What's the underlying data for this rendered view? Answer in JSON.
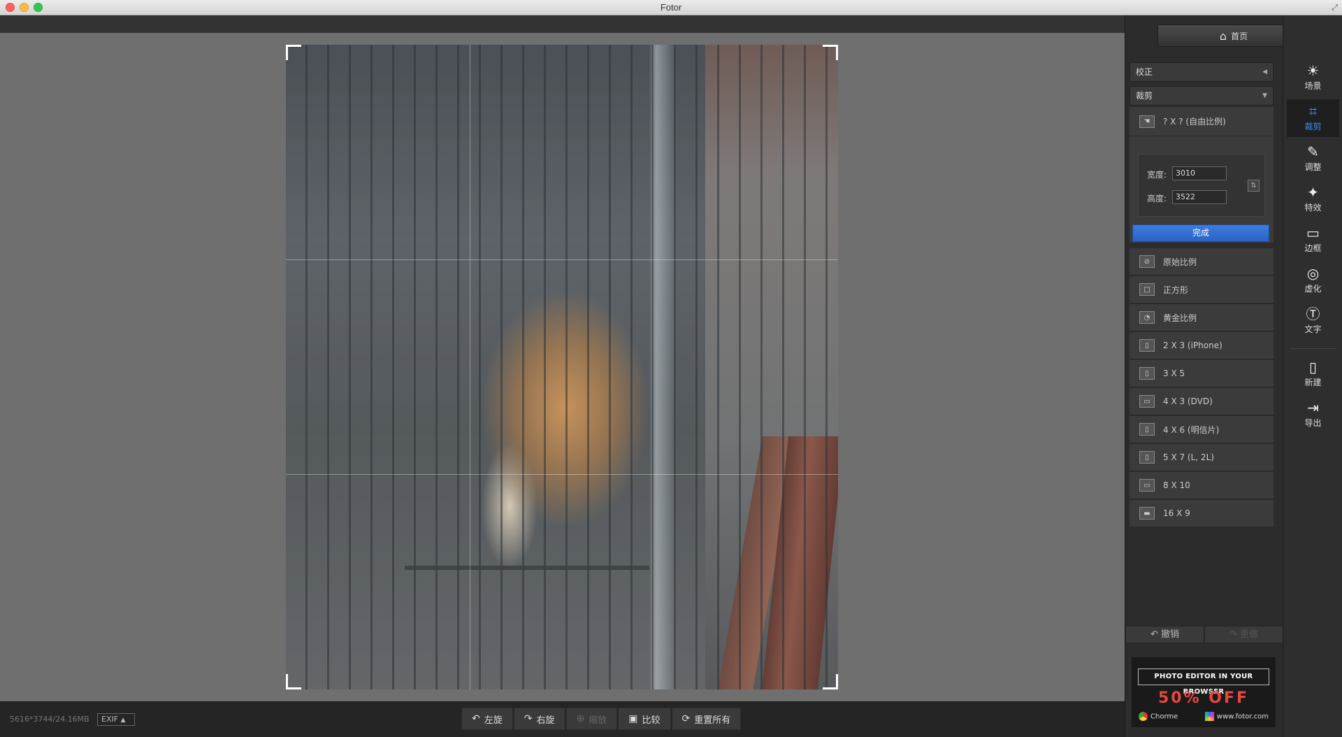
{
  "window": {
    "title": "Fotor"
  },
  "file_info": "5616*3744/24.16MB",
  "exif_label": "EXIF",
  "bottom_tools": [
    {
      "label": "左旋",
      "icon": "rotate-left-icon",
      "glyph": "↶",
      "enabled": true
    },
    {
      "label": "右旋",
      "icon": "rotate-right-icon",
      "glyph": "↷",
      "enabled": true
    },
    {
      "label": "缩放",
      "icon": "zoom-icon",
      "glyph": "⊕",
      "enabled": false
    },
    {
      "label": "比较",
      "icon": "compare-icon",
      "glyph": "▣",
      "enabled": true
    },
    {
      "label": "重置所有",
      "icon": "reset-icon",
      "glyph": "⟳",
      "enabled": true
    }
  ],
  "right_panel": {
    "home_label": "首页",
    "section_correct": "校正",
    "section_crop": "裁剪",
    "free_ratio_label": "? X ? (自由比例)",
    "width_label": "宽度:",
    "width_value": "3010",
    "height_label": "高度:",
    "height_value": "3522",
    "done_label": "完成",
    "ratio_options": [
      "原始比例",
      "正方形",
      "黄金比例",
      "2 X 3 (iPhone)",
      "3 X 5",
      "4 X 3 (DVD)",
      "4 X 6 (明信片)",
      "5 X 7 (L, 2L)",
      "8 X 10",
      "16 X 9"
    ],
    "undo_label": "撤销",
    "redo_label": "重做"
  },
  "ad": {
    "headline": "PHOTO EDITOR IN YOUR BROWSER",
    "discount": "50% OFF",
    "browser": "Chorme",
    "site": "www.fotor.com"
  },
  "sidebar": [
    {
      "label": "场景",
      "icon": "scene-icon",
      "glyph": "☀",
      "active": false
    },
    {
      "label": "裁剪",
      "icon": "crop-icon",
      "glyph": "⌗",
      "active": true
    },
    {
      "label": "调整",
      "icon": "adjust-icon",
      "glyph": "✎",
      "active": false
    },
    {
      "label": "特效",
      "icon": "effects-icon",
      "glyph": "✦",
      "active": false
    },
    {
      "label": "边框",
      "icon": "frame-icon",
      "glyph": "▭",
      "active": false
    },
    {
      "label": "虚化",
      "icon": "blur-icon",
      "glyph": "◎",
      "active": false
    },
    {
      "label": "文字",
      "icon": "text-icon",
      "glyph": "Ⓣ",
      "active": false
    },
    {
      "label": "新建",
      "icon": "new-file-icon",
      "glyph": "▯",
      "active": false
    },
    {
      "label": "导出",
      "icon": "export-icon",
      "glyph": "⇥",
      "active": false
    }
  ],
  "colors": {
    "accent": "#3d8ef0",
    "done_button": "#2f6fd6",
    "ad_discount": "#e8473e"
  }
}
